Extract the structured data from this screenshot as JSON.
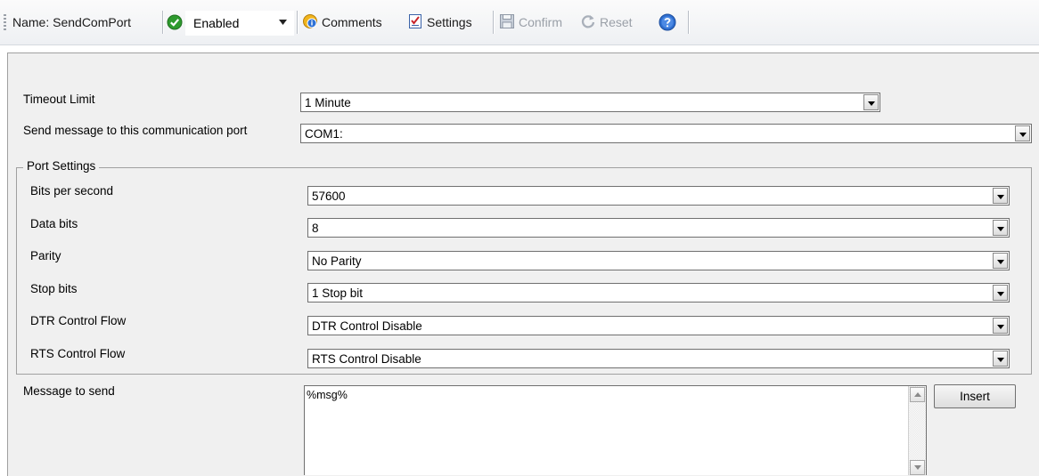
{
  "toolbar": {
    "name_label": "Name: SendComPort",
    "status_value": "Enabled",
    "comments_label": "Comments",
    "settings_label": "Settings",
    "confirm_label": "Confirm",
    "reset_label": "Reset",
    "icons": {
      "status": "check-circle-icon",
      "comments": "comments-icon",
      "settings": "settings-icon",
      "confirm": "save-icon",
      "reset": "reset-icon",
      "help": "help-icon"
    },
    "colors": {
      "status_green": "#2e9a2e",
      "help_blue": "#2f6fd0",
      "disabled_text": "#9aa0a8"
    }
  },
  "form": {
    "timeout_label": "Timeout Limit",
    "timeout_value": "1 Minute",
    "port_label": "Send message to this communication port",
    "port_value": "COM1:",
    "port_settings_title": "Port Settings",
    "bits_label": "Bits per second",
    "bits_value": "57600",
    "data_bits_label": "Data bits",
    "data_bits_value": "8",
    "parity_label": "Parity",
    "parity_value": "No Parity",
    "stop_bits_label": "Stop bits",
    "stop_bits_value": "1 Stop bit",
    "dtr_label": "DTR Control Flow",
    "dtr_value": "DTR Control Disable",
    "rts_label": "RTS Control Flow",
    "rts_value": "RTS Control Disable",
    "message_label": "Message to send",
    "message_value": "%msg%",
    "insert_label": "Insert"
  }
}
